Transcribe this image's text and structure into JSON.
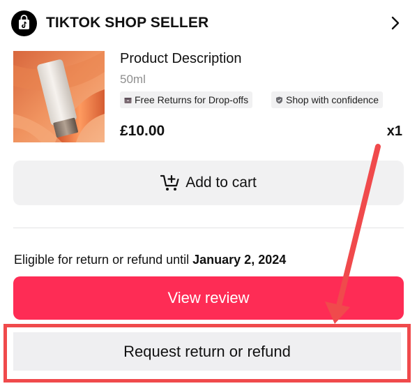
{
  "header": {
    "shop_name": "TIKTOK SHOP SELLER",
    "logo_icon": "tiktok-shop-bag-icon",
    "chevron_icon": "chevron-right-icon"
  },
  "product": {
    "title": "Product Description",
    "variant": "50ml",
    "tags": [
      {
        "label": "Free Returns for Drop-offs",
        "icon": "box-icon"
      },
      {
        "label": "Shop with confidence",
        "icon": "shield-icon"
      }
    ],
    "price": "£10.00",
    "quantity": "x1"
  },
  "actions": {
    "add_to_cart": "Add to cart",
    "eligibility_prefix": "Eligible for return or refund until ",
    "eligibility_date": "January 2, 2024",
    "view_review": "View review",
    "request_refund": "Request return or refund"
  },
  "colors": {
    "primary": "#fe2c55",
    "secondary_button_bg": "#f1f1f2",
    "annotation": "#f04a4c",
    "muted_text": "#8f8f8f"
  }
}
